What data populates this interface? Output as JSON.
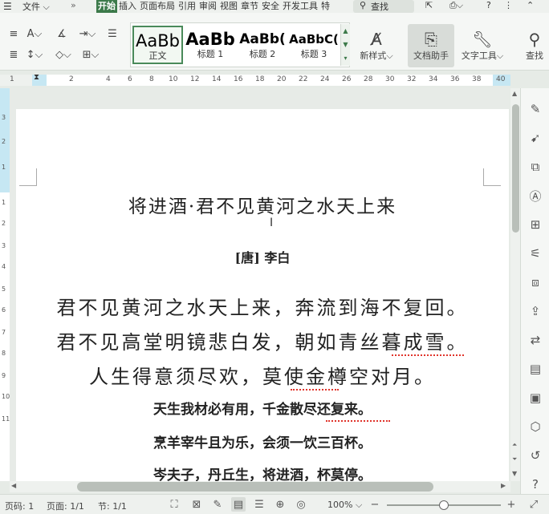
{
  "tabs": {
    "file": "文件",
    "more": "»",
    "items": [
      "开始",
      "插入",
      "页面布局",
      "引用",
      "审阅",
      "视图",
      "章节",
      "安全",
      "开发工具",
      "特"
    ],
    "search": "查找",
    "help": "?"
  },
  "ribbon": {
    "styles": [
      {
        "preview": "AaBb",
        "name": "正文"
      },
      {
        "preview": "AaBb",
        "name": "标题 1"
      },
      {
        "preview": "AaBb(",
        "name": "标题 2"
      },
      {
        "preview": "AaBbC(",
        "name": "标题 3"
      }
    ],
    "new_style": "新样式",
    "doc_assistant": "文档助手",
    "text_tools": "文字工具",
    "find_replace": "查找"
  },
  "ruler": {
    "h_marks": [
      "1",
      "2",
      "4",
      "6",
      "8",
      "10",
      "12",
      "14",
      "16",
      "18",
      "20",
      "22",
      "24",
      "26",
      "28",
      "30",
      "32",
      "34",
      "36",
      "38",
      "40"
    ],
    "v_marks": [
      "3",
      "2",
      "1",
      "1",
      "2",
      "3",
      "4",
      "5",
      "6",
      "7",
      "8",
      "9",
      "10",
      "11"
    ]
  },
  "document": {
    "title": "将进酒·君不见黄河之水天上来",
    "author_tag": "[唐]",
    "author": "李白",
    "lines": [
      "君不见黄河之水天上来，奔流到海不复回。",
      "君不见高堂明镜悲白发，朝如青丝暮成雪。",
      "人生得意须尽欢，莫使金樽空对月。",
      "天生我材必有用，千金散尽还复来。",
      "烹羊宰牛且为乐，会须一饮三百杯。",
      "岑夫子，丹丘生，将进酒，杯莫停。"
    ]
  },
  "status": {
    "page_code": "页码: 1",
    "page": "页面: 1/1",
    "section": "节: 1/1",
    "zoom": "100%",
    "zoom_level": 0.5
  }
}
